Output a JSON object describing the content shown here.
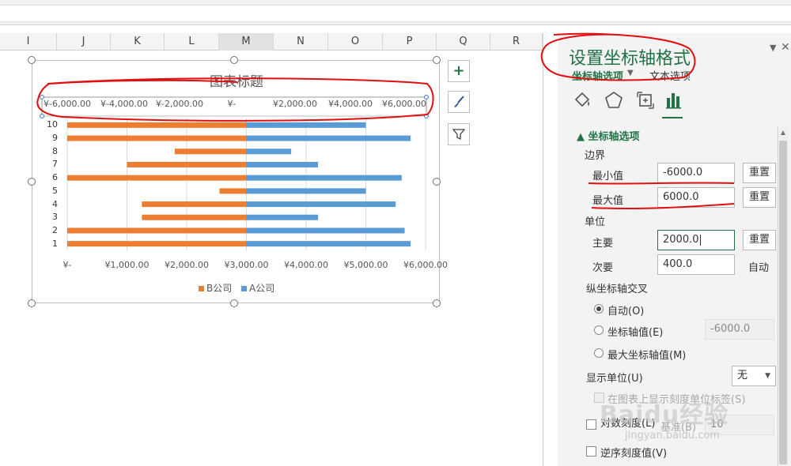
{
  "colors": {
    "series_b": "#ED7D31",
    "series_a": "#5B9BD5",
    "accent": "#217346",
    "annotation": "#E01010"
  },
  "columns": [
    {
      "label": "I",
      "selected": false
    },
    {
      "label": "J",
      "selected": false
    },
    {
      "label": "K",
      "selected": false
    },
    {
      "label": "L",
      "selected": false
    },
    {
      "label": "M",
      "selected": true
    },
    {
      "label": "N",
      "selected": false
    },
    {
      "label": "O",
      "selected": false
    },
    {
      "label": "P",
      "selected": false
    },
    {
      "label": "Q",
      "selected": false
    },
    {
      "label": "R",
      "selected": false
    }
  ],
  "chart_data": {
    "type": "bar",
    "orientation": "horizontal",
    "title": "图表标题",
    "categories": [
      "1",
      "2",
      "3",
      "4",
      "5",
      "6",
      "7",
      "8",
      "9",
      "10"
    ],
    "series": [
      {
        "name": "B公司",
        "color": "#ED7D31",
        "values": [
          3000,
          3000,
          1750,
          1750,
          450,
          3000,
          2000,
          1200,
          3000,
          3000
        ]
      },
      {
        "name": "A公司",
        "color": "#5B9BD5",
        "values": [
          5750,
          5650,
          4200,
          5500,
          5000,
          5600,
          4200,
          3750,
          5750,
          5000
        ]
      }
    ],
    "top_axis": {
      "ticks": [
        "¥-6,000.00",
        "¥-4,000.00",
        "¥-2,000.00",
        "¥-",
        "¥2,000.00",
        "¥4,000.00",
        "¥6,000.00"
      ],
      "range": [
        -6000,
        6000
      ]
    },
    "bottom_axis": {
      "ticks": [
        "¥-",
        "¥1,000.00",
        "¥2,000.00",
        "¥3,000.00",
        "¥4,000.00",
        "¥5,000.00",
        "¥6,000.00"
      ],
      "range": [
        0,
        6000
      ]
    },
    "legend": {
      "position": "bottom",
      "entries": [
        "B公司",
        "A公司"
      ]
    },
    "grid": true
  },
  "chart_buttons": {
    "add_elements": "+",
    "styles": "brush",
    "filters": "funnel"
  },
  "pane": {
    "title": "设置坐标轴格式",
    "tab_axis_options": "坐标轴选项",
    "tab_text_options": "文本选项",
    "section": "坐标轴选项",
    "bounds": {
      "label": "边界",
      "min_label": "最小值",
      "min_value": "-6000.0",
      "max_label": "最大值",
      "max_value": "6000.0",
      "reset": "重置"
    },
    "units": {
      "label": "单位",
      "major_label": "主要",
      "major_value": "2000.0",
      "minor_label": "次要",
      "minor_value": "400.0",
      "auto": "自动",
      "reset": "重置"
    },
    "crosses": {
      "label": "纵坐标轴交叉",
      "auto": "自动(O)",
      "axis_value": "坐标轴值(E)",
      "axis_value_input": "-6000.0",
      "max_value": "最大坐标轴值(M)"
    },
    "display_units": {
      "label": "显示单位(U)",
      "value": "无"
    },
    "show_units_label": "在图表上显示刻度单位标签(S)",
    "log_scale": "对数刻度(L)",
    "log_base_label": "基准(B)",
    "log_base_value": "10",
    "reverse_order": "逆序刻度值(V)"
  },
  "watermark": {
    "text": "Baidu经验",
    "url": "jingyan.baidu.com"
  }
}
